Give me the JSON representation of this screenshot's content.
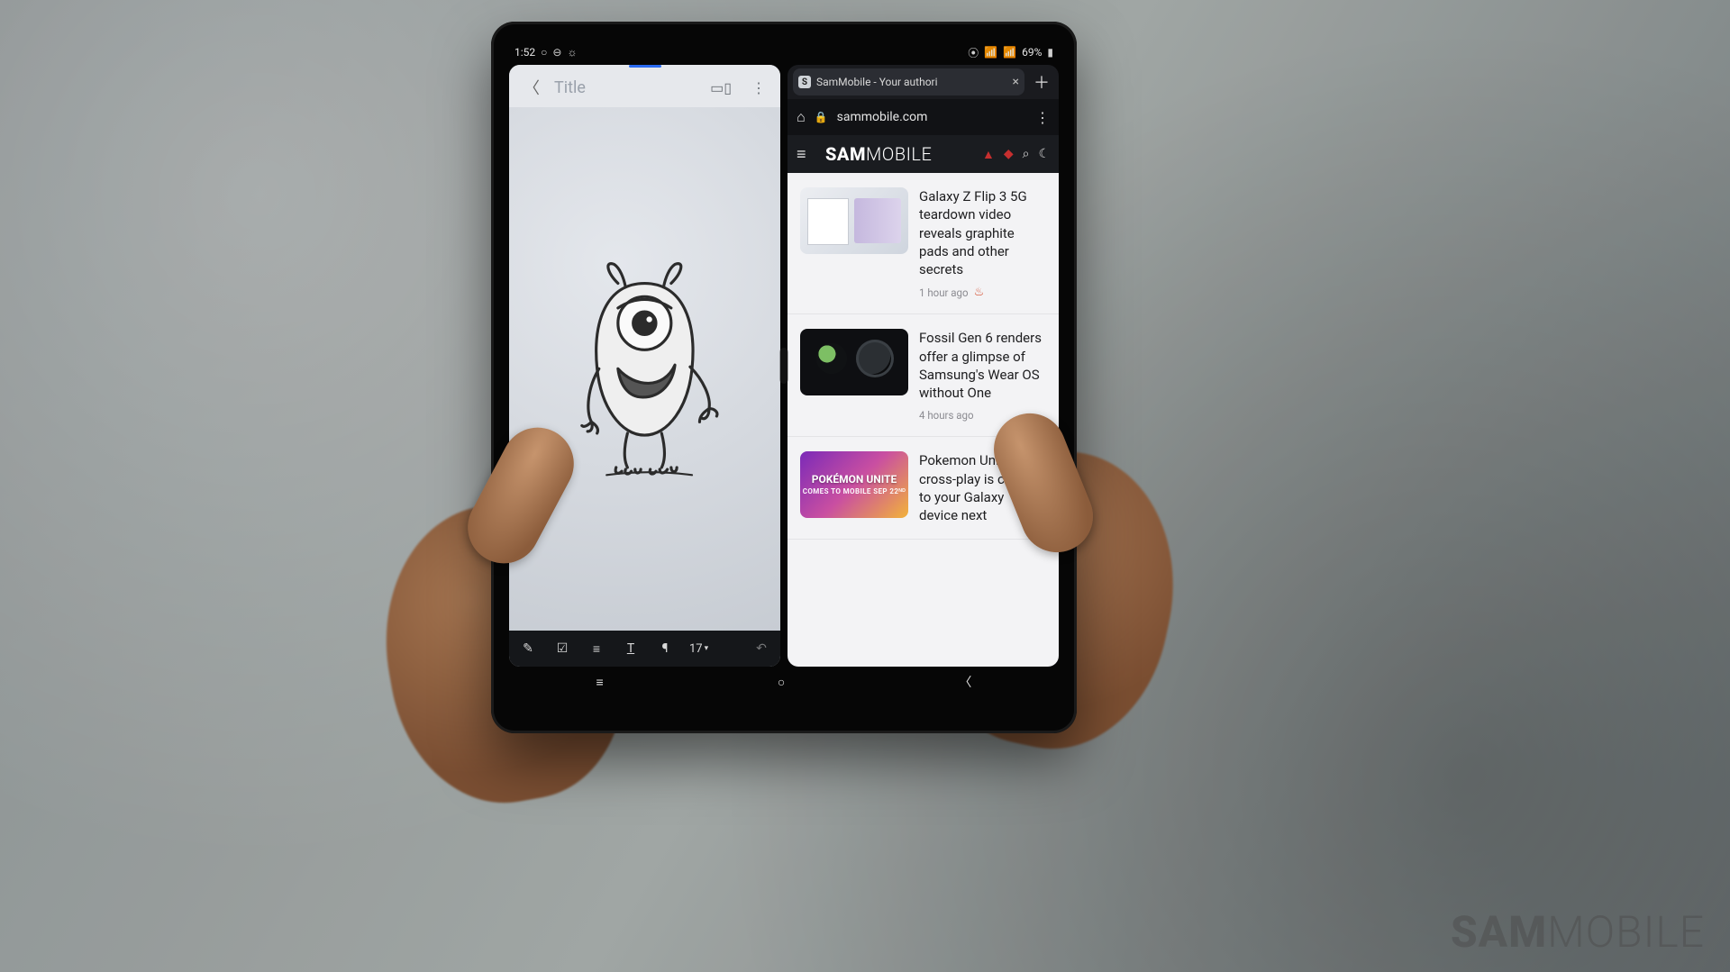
{
  "watermark": {
    "bold": "SAM",
    "light": "MOBILE"
  },
  "status": {
    "time": "1:52",
    "icons_left": [
      "○",
      "⊖",
      "☼"
    ],
    "icons_right": [
      "⦿",
      "📶",
      "📶",
      "LTE1",
      "LTE2"
    ],
    "battery_text": "69%"
  },
  "notes": {
    "title_placeholder": "Title",
    "toolbar_footer": {
      "pen": "✎",
      "check": "☑",
      "align": "≡",
      "text_style": "T",
      "paragraph": "¶",
      "font_size": "17",
      "undo": "↶"
    }
  },
  "browser": {
    "tab_title": "SamMobile - Your authori",
    "tab_favicon_letter": "S",
    "url": "sammobile.com",
    "brand_bold": "SAM",
    "brand_light": "MOBILE",
    "articles": [
      {
        "title": "Galaxy Z Flip 3 5G teardown video reveals graphite pads and other secrets",
        "meta": "1 hour ago",
        "trending": true,
        "thumb_class": "t1"
      },
      {
        "title": "Fossil Gen 6 renders offer a glimpse of Samsung's Wear OS without One",
        "meta": "4 hours ago",
        "trending": false,
        "thumb_class": "t2"
      },
      {
        "title": "Pokemon Unite with cross-play is coming to your Galaxy device next",
        "meta": "",
        "trending": false,
        "thumb_class": "t3",
        "thumb_line1": "POKÉMON UNITE",
        "thumb_line2": "COMES TO MOBILE SEP 22ᴺᴰ"
      }
    ]
  },
  "nav": {
    "recent": "≡",
    "home": "○",
    "back": "〈"
  }
}
